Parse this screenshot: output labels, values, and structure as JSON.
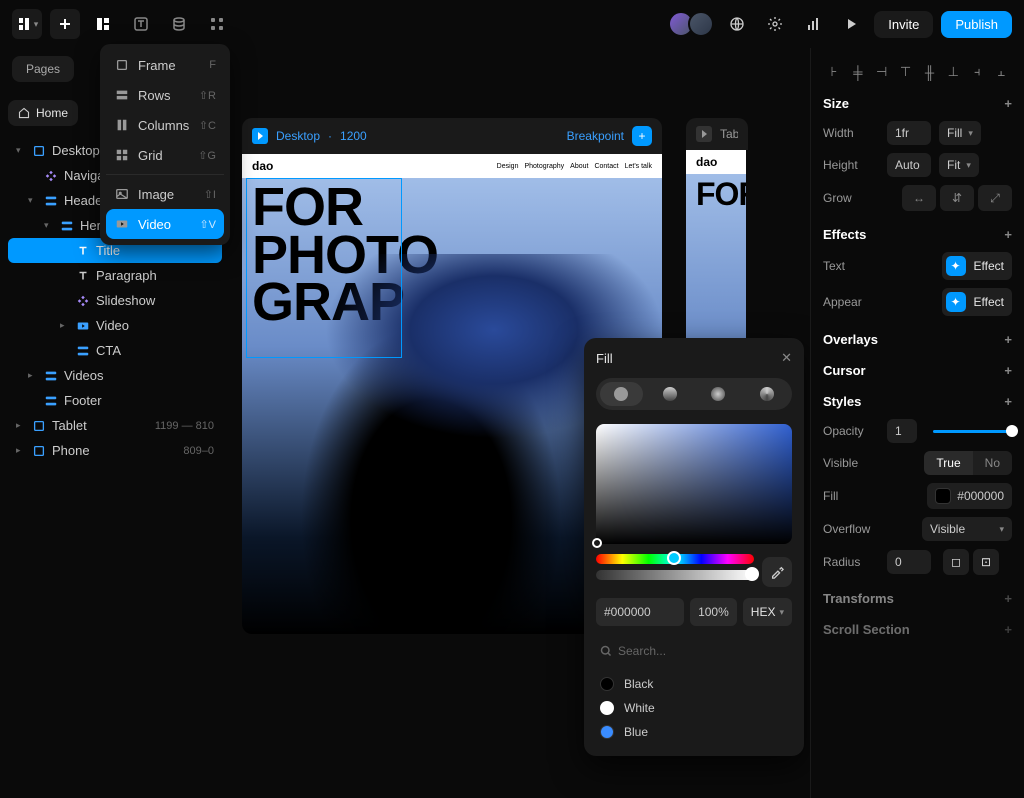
{
  "topbar": {
    "invite": "Invite",
    "publish": "Publish"
  },
  "sidebar": {
    "pages_label": "Pages",
    "home": "Home",
    "tree": [
      {
        "label": "Desktop",
        "icon": "frame",
        "indent": 0,
        "caret": "▾"
      },
      {
        "label": "Navigation",
        "icon": "component",
        "indent": 1,
        "caret": ""
      },
      {
        "label": "Header",
        "icon": "stack",
        "indent": 1,
        "caret": "▾"
      },
      {
        "label": "Hero",
        "icon": "stack",
        "indent": 2,
        "caret": "▾"
      },
      {
        "label": "Title",
        "icon": "text",
        "indent": 3,
        "caret": "",
        "active": true
      },
      {
        "label": "Paragraph",
        "icon": "text",
        "indent": 3,
        "caret": ""
      },
      {
        "label": "Slideshow",
        "icon": "component",
        "indent": 3,
        "caret": ""
      },
      {
        "label": "Video",
        "icon": "video",
        "indent": 3,
        "caret": "▸"
      },
      {
        "label": "CTA",
        "icon": "stack",
        "indent": 3,
        "caret": ""
      },
      {
        "label": "Videos",
        "icon": "stack",
        "indent": 1,
        "caret": "▸"
      },
      {
        "label": "Footer",
        "icon": "stack",
        "indent": 1,
        "caret": ""
      },
      {
        "label": "Tablet",
        "icon": "frame",
        "indent": 0,
        "caret": "▸",
        "meta": "1199 — 810"
      },
      {
        "label": "Phone",
        "icon": "frame",
        "indent": 0,
        "caret": "▸",
        "meta": "809–0"
      }
    ]
  },
  "insert_menu": [
    {
      "label": "Frame",
      "short": "F",
      "icon": "frame"
    },
    {
      "label": "Rows",
      "short": "⇧R",
      "icon": "rows"
    },
    {
      "label": "Columns",
      "short": "⇧C",
      "icon": "columns"
    },
    {
      "label": "Grid",
      "short": "⇧G",
      "icon": "grid"
    },
    {
      "label": "Image",
      "short": "⇧I",
      "icon": "image",
      "sep": true
    },
    {
      "label": "Video",
      "short": "⇧V",
      "icon": "video",
      "active": true
    }
  ],
  "canvas": {
    "breakpoint_label": "Breakpoint",
    "artboards": [
      {
        "name": "Desktop",
        "width": "1200"
      },
      {
        "name": "Tablet"
      }
    ],
    "mockup": {
      "logo": "dao",
      "nav": [
        "Design",
        "Photography",
        "About",
        "Contact",
        "Let's talk"
      ],
      "hero_line1": "FOR",
      "hero_line2": "PHOTO",
      "hero_line3": "GRAP"
    }
  },
  "fill_popup": {
    "title": "Fill",
    "hex": "#000000",
    "alpha": "100%",
    "format": "HEX",
    "search_placeholder": "Search...",
    "swatches": [
      {
        "name": "Black",
        "color": "#000000"
      },
      {
        "name": "White",
        "color": "#ffffff"
      },
      {
        "name": "Blue",
        "color": "#3a8cff"
      }
    ]
  },
  "props": {
    "size": {
      "title": "Size",
      "width_label": "Width",
      "width_val": "1fr",
      "width_mode": "Fill",
      "height_label": "Height",
      "height_val": "Auto",
      "height_mode": "Fit",
      "grow_label": "Grow"
    },
    "effects": {
      "title": "Effects",
      "text_label": "Text",
      "appear_label": "Appear",
      "effect_btn": "Effect"
    },
    "overlays": {
      "title": "Overlays"
    },
    "cursor": {
      "title": "Cursor"
    },
    "styles": {
      "title": "Styles",
      "opacity_label": "Opacity",
      "opacity_val": "1",
      "visible_label": "Visible",
      "visible_true": "True",
      "visible_false": "No",
      "fill_label": "Fill",
      "fill_val": "#000000",
      "overflow_label": "Overflow",
      "overflow_val": "Visible",
      "radius_label": "Radius",
      "radius_val": "0"
    },
    "transforms": {
      "title": "Transforms"
    },
    "scroll": {
      "title": "Scroll Section"
    }
  }
}
